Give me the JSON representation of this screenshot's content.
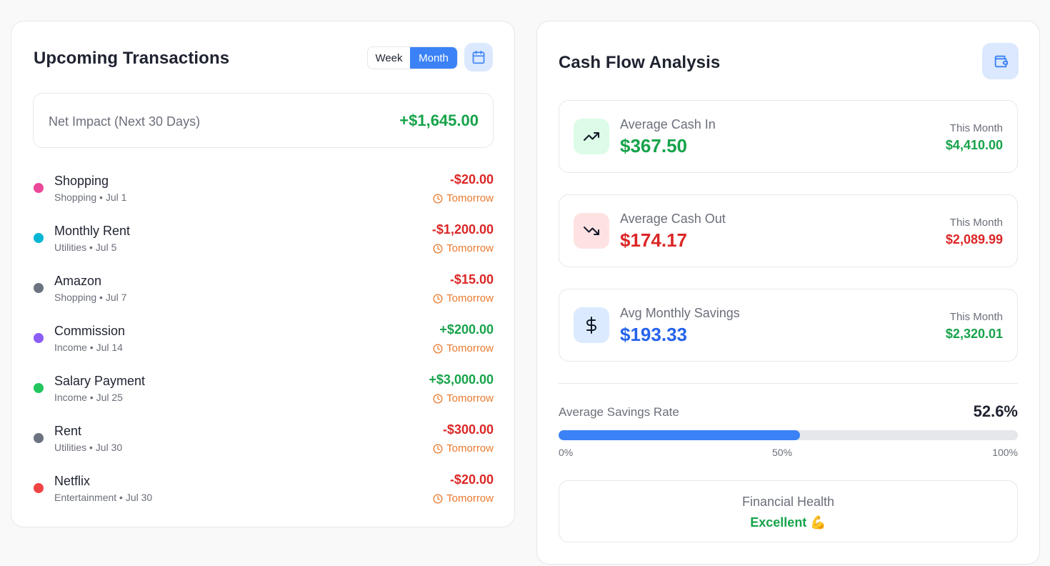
{
  "upcoming": {
    "title": "Upcoming Transactions",
    "toggle": {
      "week_label": "Week",
      "month_label": "Month",
      "selected": "Month"
    },
    "calendar_icon": "calendar-icon",
    "net_impact": {
      "label": "Net Impact (Next 30 Days)",
      "value": "+$1,645.00",
      "color": "#16a34a"
    },
    "transactions": [
      {
        "name": "Shopping",
        "sub": "Shopping • Jul 1",
        "amount": "-$20.00",
        "when": "Tomorrow",
        "dot_color": "#ec4899",
        "amount_color": "#dc2626"
      },
      {
        "name": "Monthly Rent",
        "sub": "Utilities • Jul 5",
        "amount": "-$1,200.00",
        "when": "Tomorrow",
        "dot_color": "#06b6d4",
        "amount_color": "#dc2626"
      },
      {
        "name": "Amazon",
        "sub": "Shopping • Jul 7",
        "amount": "-$15.00",
        "when": "Tomorrow",
        "dot_color": "#6b7280",
        "amount_color": "#dc2626"
      },
      {
        "name": "Commission",
        "sub": "Income • Jul 14",
        "amount": "+$200.00",
        "when": "Tomorrow",
        "dot_color": "#8b5cf6",
        "amount_color": "#16a34a"
      },
      {
        "name": "Salary Payment",
        "sub": "Income • Jul 25",
        "amount": "+$3,000.00",
        "when": "Tomorrow",
        "dot_color": "#22c55e",
        "amount_color": "#16a34a"
      },
      {
        "name": "Rent",
        "sub": "Utilities • Jul 30",
        "amount": "-$300.00",
        "when": "Tomorrow",
        "dot_color": "#6b7280",
        "amount_color": "#dc2626"
      },
      {
        "name": "Netflix",
        "sub": "Entertainment • Jul 30",
        "amount": "-$20.00",
        "when": "Tomorrow",
        "dot_color": "#ef4444",
        "amount_color": "#dc2626"
      }
    ]
  },
  "cashflow": {
    "title": "Cash Flow Analysis",
    "wallet_icon": "wallet-icon",
    "stats": [
      {
        "label": "Average Cash In",
        "value": "$367.50",
        "month_label": "This Month",
        "month_value": "$4,410.00",
        "icon": "trending-up-icon",
        "icon_bg": "#dcfce7",
        "value_color": "#16a34a",
        "month_color": "#16a34a"
      },
      {
        "label": "Average Cash Out",
        "value": "$174.17",
        "month_label": "This Month",
        "month_value": "$2,089.99",
        "icon": "trending-down-icon",
        "icon_bg": "#fee2e2",
        "value_color": "#dc2626",
        "month_color": "#dc2626"
      },
      {
        "label": "Avg Monthly Savings",
        "value": "$193.33",
        "month_label": "This Month",
        "month_value": "$2,320.01",
        "icon": "dollar-icon",
        "icon_bg": "#dbeafe",
        "value_color": "#2563eb",
        "month_color": "#16a34a"
      }
    ],
    "savings_rate": {
      "label": "Average Savings Rate",
      "value": "52.6%",
      "percent": 52.6,
      "ticks": [
        "0%",
        "50%",
        "100%"
      ]
    },
    "health": {
      "label": "Financial Health",
      "value": "Excellent 💪"
    }
  }
}
